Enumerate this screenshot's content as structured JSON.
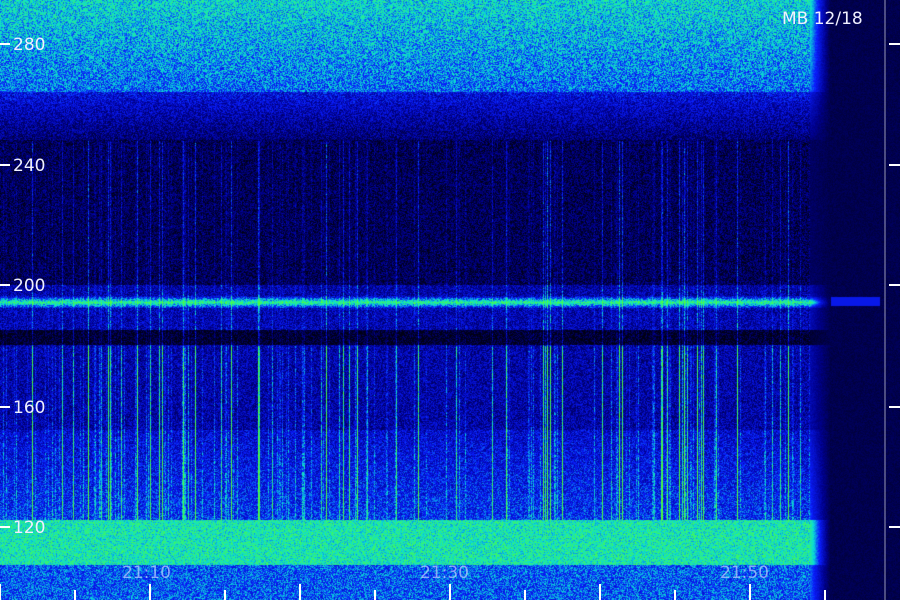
{
  "image": {
    "corner_label": "MB 12/18",
    "frequency_labels": [
      "280",
      "240",
      "200",
      "160",
      "120"
    ],
    "time_labels": [
      "21:10",
      "21:30",
      "21:50"
    ],
    "palette": {
      "background": "#00001a",
      "low": "#000060",
      "mid": "#1030ff",
      "high": "#00e0e0",
      "peak": "#40ff40"
    }
  }
}
